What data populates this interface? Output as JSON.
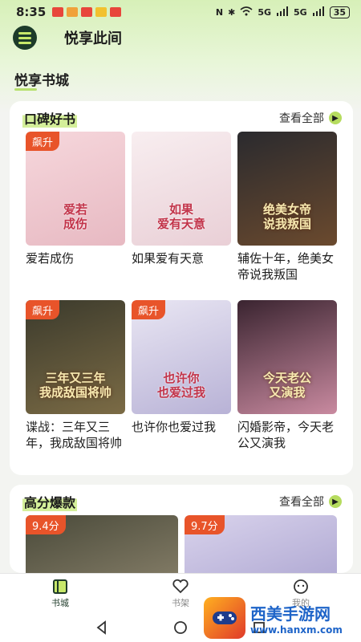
{
  "status_bar": {
    "time": "8:35",
    "network": "5G",
    "battery": "35"
  },
  "app": {
    "title": "悦享此间"
  },
  "tab": {
    "label": "悦享书城"
  },
  "section1": {
    "title": "口碑好书",
    "view_all": "查看全部",
    "books": [
      {
        "title": "爱若成伤",
        "badge": "飙升",
        "cover_text": "爱若\n成伤",
        "cover_colors": [
          "#f6d7dc",
          "#e7b9c2"
        ]
      },
      {
        "title": "如果爱有天意",
        "badge": "",
        "cover_text": "如果\n爱有天意",
        "cover_colors": [
          "#f8eef0",
          "#e9cfd6"
        ]
      },
      {
        "title": "辅佐十年，绝美女帝说我叛国",
        "badge": "",
        "cover_text": "绝美女帝\n说我叛国",
        "cover_colors": [
          "#2a2a2e",
          "#6b4a2e"
        ]
      },
      {
        "title": "谍战：三年又三年，我成敌国将帅",
        "badge": "飙升",
        "cover_text": "三年又三年\n我成敌国将帅",
        "cover_colors": [
          "#3b3a2c",
          "#7b6b45"
        ]
      },
      {
        "title": "也许你也爱过我",
        "badge": "飙升",
        "cover_text": "也许你\n也爱过我",
        "cover_colors": [
          "#e9e6f3",
          "#b8b2d6"
        ]
      },
      {
        "title": "闪婚影帝，今天老公又演我",
        "badge": "",
        "cover_text": "今天老公\n又演我",
        "cover_colors": [
          "#3a2430",
          "#c98aa0"
        ]
      }
    ]
  },
  "section2": {
    "title": "高分爆款",
    "view_all": "查看全部",
    "books": [
      {
        "badge": "9.4分",
        "cover_colors": [
          "#4a4a3a",
          "#9a9078"
        ]
      },
      {
        "badge": "9.7分",
        "cover_colors": [
          "#d9d3ec",
          "#9f98c9"
        ]
      }
    ]
  },
  "nav": {
    "items": [
      {
        "label": "书城",
        "icon": "book-city-icon",
        "active": true
      },
      {
        "label": "书架",
        "icon": "heart-icon",
        "active": false
      },
      {
        "label": "我的",
        "icon": "chat-smile-icon",
        "active": false
      }
    ]
  },
  "watermark": {
    "title": "西美手游网",
    "url": "www.hanxm.com"
  },
  "colors": {
    "accent": "#b6dc5f",
    "badge": "#e8542a",
    "brand_dark": "#1d3b2a"
  }
}
